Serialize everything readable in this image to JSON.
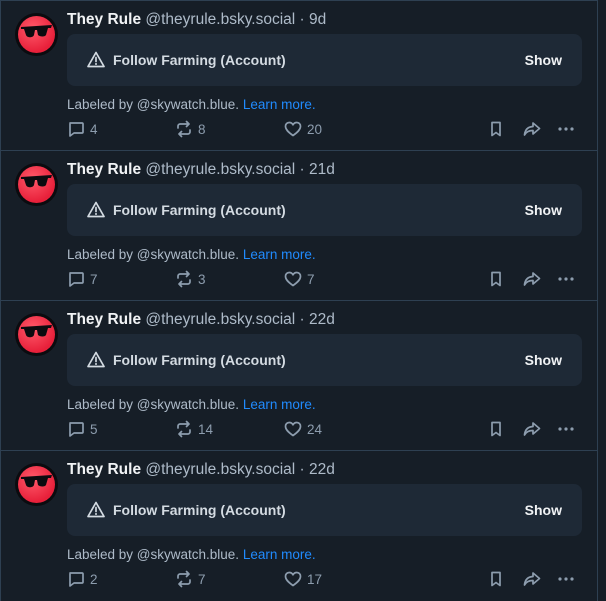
{
  "posts": [
    {
      "author": "They Rule",
      "handle": "@theyrule.bsky.social",
      "time": "· 9d",
      "warning": "Follow Farming (Account)",
      "show_label": "Show",
      "labeled_by": "Labeled by @skywatch.blue.",
      "learn_more": "Learn more.",
      "replies": "4",
      "reposts": "8",
      "likes": "20"
    },
    {
      "author": "They Rule",
      "handle": "@theyrule.bsky.social",
      "time": "· 21d",
      "warning": "Follow Farming (Account)",
      "show_label": "Show",
      "labeled_by": "Labeled by @skywatch.blue.",
      "learn_more": "Learn more.",
      "replies": "7",
      "reposts": "3",
      "likes": "7"
    },
    {
      "author": "They Rule",
      "handle": "@theyrule.bsky.social",
      "time": "· 22d",
      "warning": "Follow Farming (Account)",
      "show_label": "Show",
      "labeled_by": "Labeled by @skywatch.blue.",
      "learn_more": "Learn more.",
      "replies": "5",
      "reposts": "14",
      "likes": "24"
    },
    {
      "author": "They Rule",
      "handle": "@theyrule.bsky.social",
      "time": "· 22d",
      "warning": "Follow Farming (Account)",
      "show_label": "Show",
      "labeled_by": "Labeled by @skywatch.blue.",
      "learn_more": "Learn more.",
      "replies": "2",
      "reposts": "7",
      "likes": "17"
    }
  ],
  "icons": {
    "avatar": "sunglasses-avatar-icon",
    "warning": "warning-triangle-icon",
    "reply": "reply-bubble-icon",
    "repost": "repost-icon",
    "like": "heart-icon",
    "bookmark": "bookmark-icon",
    "share": "share-arrow-icon",
    "more": "more-dots-icon"
  },
  "colors": {
    "background": "#161e27",
    "warning_box": "#1e2936",
    "link": "#208bfe",
    "muted": "#aebbc9",
    "avatar_red": "#e8203a"
  }
}
